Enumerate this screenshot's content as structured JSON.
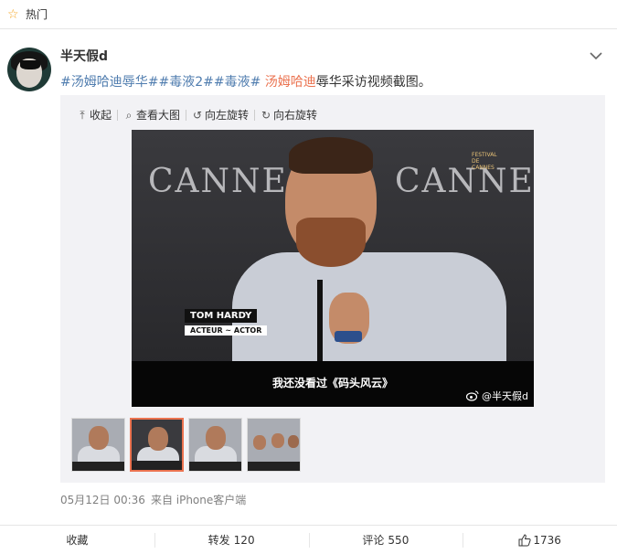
{
  "topbar": {
    "label": "热门",
    "icon": "star-icon",
    "accent": "#f5a623"
  },
  "post": {
    "username": "半天假d",
    "content": {
      "tag1": "#汤姆哈迪",
      "tag2": "辱华##毒液2##毒液#",
      "tag3": " 汤姆哈迪",
      "text": "辱华采访视频截图。"
    },
    "toolbar": {
      "collapse": "收起",
      "view_large": "查看大图",
      "rotate_left": "向左旋转",
      "rotate_right": "向右旋转"
    },
    "image": {
      "cannes_left": "CANNES",
      "cannes_right": "CANNES",
      "festival_badge": "FESTIVAL DE CANNES",
      "name_line": "TOM HARDY",
      "role_line": "ACTEUR ~ ACTOR",
      "subtitle": "我还没看过《码头风云》",
      "watermark": "@半天假d"
    },
    "thumbnails_selected_index": 1,
    "meta": {
      "time": "05月12日 00:36",
      "source": "来自 iPhone客户端"
    }
  },
  "actions": {
    "favorite": "收藏",
    "repost_label": "转发",
    "repost_count": "120",
    "comment_label": "评论",
    "comment_count": "550",
    "like_count": "1736"
  },
  "colors": {
    "tag_orange": "#eb7350",
    "tag_blue": "#507daf",
    "meta_gray": "#808080"
  }
}
